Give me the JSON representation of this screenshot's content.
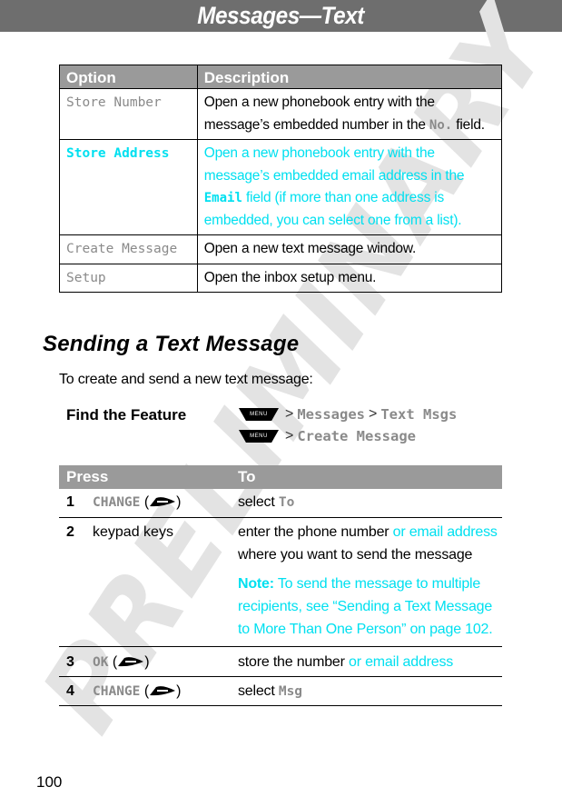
{
  "header": {
    "title": "Messages—Text"
  },
  "watermark": "PRELIMINARY",
  "colors": {
    "header_band": "#6e6e6e",
    "table_header": "#9a9a9a",
    "highlight_cyan": "#00e0f0",
    "menu_item_gray": "#8a8a8a"
  },
  "options_table": {
    "headers": [
      "Option",
      "Description"
    ],
    "rows": [
      {
        "option": "Store Number",
        "highlight": false,
        "desc_parts": [
          "Open a new phonebook entry with the message’s embedded number in the ",
          "No.",
          " field."
        ]
      },
      {
        "option": "Store Address",
        "highlight": true,
        "desc_parts": [
          "Open a new phonebook entry with the message’s embedded email address in the ",
          "Email",
          " field (if more than one address is embedded, you can select one from a list)."
        ]
      },
      {
        "option": "Create Message",
        "highlight": false,
        "desc": "Open a new text message window."
      },
      {
        "option": "Setup",
        "highlight": false,
        "desc": "Open the inbox setup menu."
      }
    ]
  },
  "section": {
    "title": "Sending a Text Message",
    "intro": "To create and send a new text message:"
  },
  "find_feature": {
    "label": "Find the Feature",
    "menu_key_label": "MENU",
    "separator": ">",
    "paths": [
      [
        "Messages",
        "Text Msgs"
      ],
      [
        "Create Message"
      ]
    ]
  },
  "steps_table": {
    "headers": [
      "Press",
      "To"
    ],
    "rows": [
      {
        "num": "1",
        "key": "CHANGE",
        "key_icon": "softkey-icon",
        "to_parts": [
          "select ",
          "To"
        ]
      },
      {
        "num": "2",
        "press": "keypad keys",
        "to_parts": [
          "enter the phone number ",
          "or email address",
          " where you want to send the message"
        ],
        "note_label": "Note:",
        "note_text": " To send the message to multiple recipients, see “Sending a Text Message to More Than One Person” on page 102."
      },
      {
        "num": "3",
        "key": "OK",
        "key_icon": "softkey-icon",
        "to_parts": [
          "store the number ",
          "or email address"
        ]
      },
      {
        "num": "4",
        "key": "CHANGE",
        "key_icon": "softkey-icon",
        "to_parts": [
          "select ",
          "Msg"
        ]
      }
    ]
  },
  "page_number": "100"
}
